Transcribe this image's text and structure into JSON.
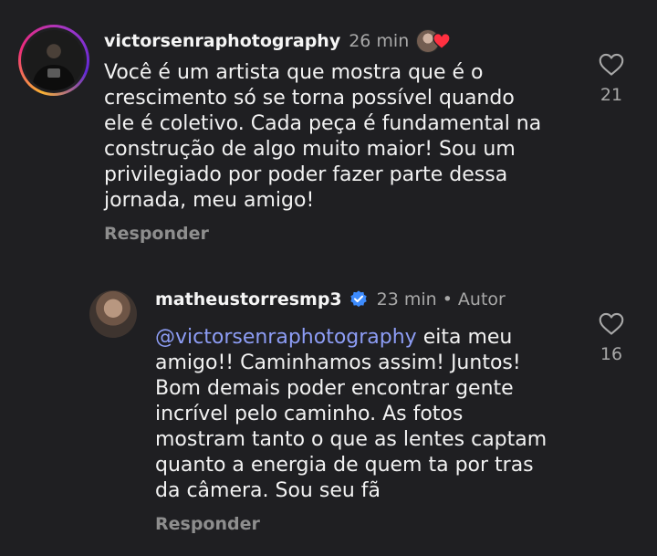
{
  "comments": [
    {
      "username": "victorsenraphotography",
      "time": "26 min",
      "text": "Você é um artista que mostra que é o\ncrescimento só se torna possível quando\nele é coletivo. Cada peça é fundamental na\nconstrução de algo muito maior! Sou um\nprivilegiado por poder fazer parte dessa\njornada, meu amigo!",
      "reply_label": "Responder",
      "likes": "21",
      "avatar_icon": "profile-photo-story-ring",
      "liked_by_author_icon": "author-liked-heart-icon"
    },
    {
      "username": "matheustorresmp3",
      "verified": true,
      "time": "23 min",
      "separator": "•",
      "author_label": "Autor",
      "mention": "@victorsenraphotography",
      "text": " eita meu\namigo!! Caminhamos assim! Juntos!\nBom demais poder encontrar gente\nincrível pelo caminho. As fotos\nmostram tanto o que as lentes captam\nquanto a energia de quem ta por tras\nda câmera. Sou seu fã",
      "reply_label": "Responder",
      "likes": "16",
      "avatar_icon": "profile-photo"
    }
  ],
  "colors": {
    "background": "#1f1f22",
    "text": "#f2f2f2",
    "muted": "#a8a8a8",
    "mention": "#8d9df5",
    "verified": "#3d8bfd",
    "heart_red": "#ff3040"
  }
}
